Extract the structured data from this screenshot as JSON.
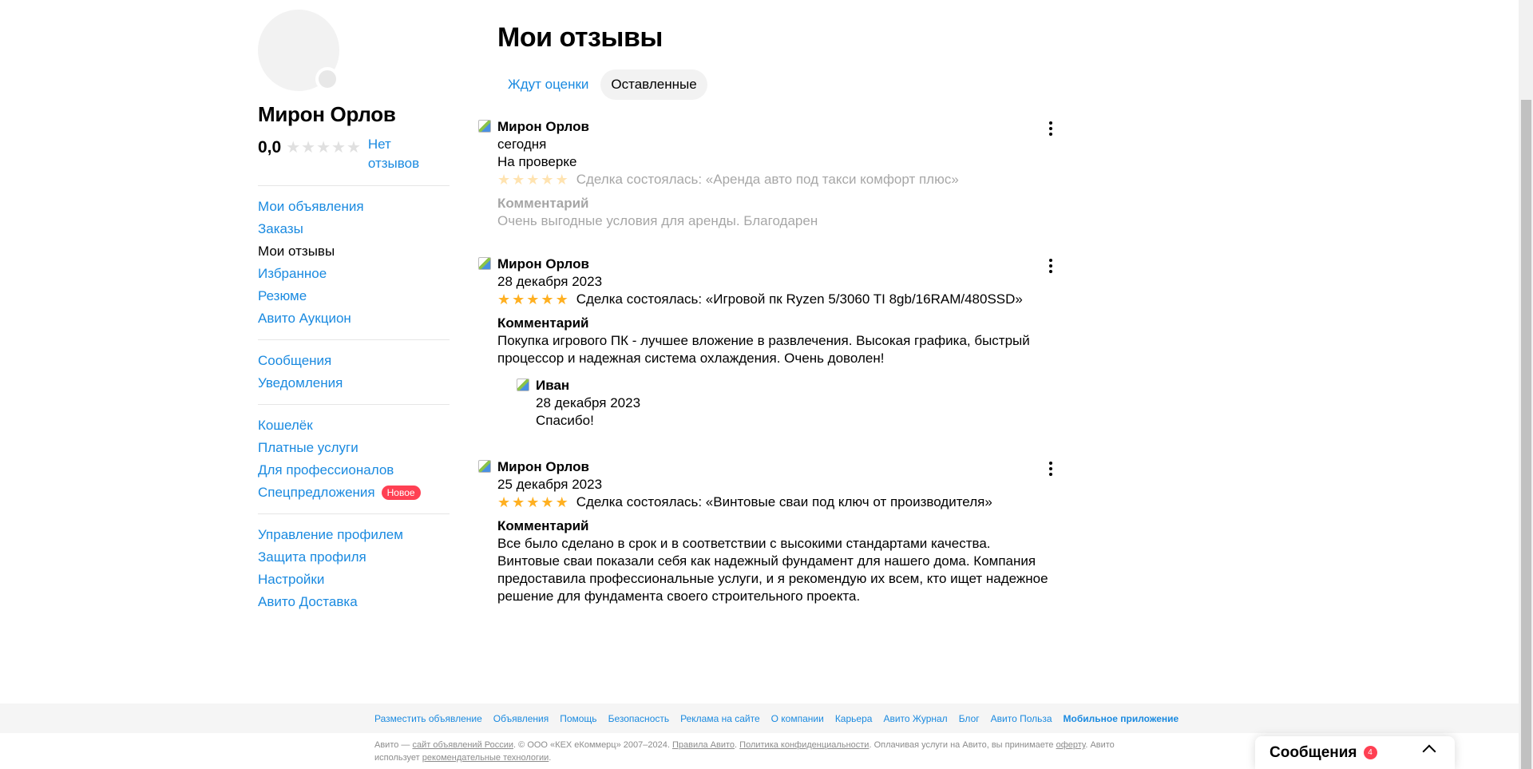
{
  "sidebar": {
    "name": "Мирон Орлов",
    "rating": "0,0",
    "no_reviews": "Нет отзывов",
    "groups": [
      [
        {
          "label": "Мои объявления",
          "active": false
        },
        {
          "label": "Заказы",
          "active": false
        },
        {
          "label": "Мои отзывы",
          "active": true
        },
        {
          "label": "Избранное",
          "active": false
        },
        {
          "label": "Резюме",
          "active": false
        },
        {
          "label": "Авито Аукцион",
          "active": false
        }
      ],
      [
        {
          "label": "Сообщения",
          "active": false
        },
        {
          "label": "Уведомления",
          "active": false
        }
      ],
      [
        {
          "label": "Кошелёк",
          "active": false
        },
        {
          "label": "Платные услуги",
          "active": false
        },
        {
          "label": "Для профессионалов",
          "active": false
        },
        {
          "label": "Спецпредложения",
          "active": false,
          "badge": "Новое"
        }
      ],
      [
        {
          "label": "Управление профилем",
          "active": false
        },
        {
          "label": "Защита профиля",
          "active": false
        },
        {
          "label": "Настройки",
          "active": false
        },
        {
          "label": "Авито Доставка",
          "active": false
        }
      ]
    ]
  },
  "main": {
    "title": "Мои отзывы",
    "tabs": [
      {
        "label": "Ждут оценки",
        "active": false
      },
      {
        "label": "Оставленные",
        "active": true
      }
    ],
    "reviews": [
      {
        "author": "Мирон Орлов",
        "date": "сегодня",
        "status": "На проверке",
        "rating": 5,
        "deal": "Сделка состоялась: «Аренда авто под такси комфорт плюс»",
        "comment_title": "Комментарий",
        "comment": "Очень выгодные условия для аренды. Благодарен",
        "faded": true
      },
      {
        "author": "Мирон Орлов",
        "date": "28 декабря 2023",
        "rating": 5,
        "deal": "Сделка состоялась: «Игровой пк Ryzen 5/3060 TI 8gb/16RAM/480SSD»",
        "comment_title": "Комментарий",
        "comment": "Покупка игрового ПК - лучшее вложение в развлечения. Высокая графика, быстрый процессор и надежная система охлаждения. Очень доволен!",
        "reply": {
          "author": "Иван",
          "date": "28 декабря 2023",
          "text": "Спасибо!"
        }
      },
      {
        "author": "Мирон Орлов",
        "date": "25 декабря 2023",
        "rating": 5,
        "deal": "Сделка состоялась: «Винтовые сваи под ключ от производителя»",
        "comment_title": "Комментарий",
        "comment": "Все было сделано в срок и в соответствии с высокими стандартами качества. Винтовые сваи показали себя как надежный фундамент для нашего дома. Компания предоставила профессиональные услуги, и я рекомендую их всем, кто ищет надежное решение для фундамента своего строительного проекта."
      }
    ]
  },
  "footer": {
    "links": [
      {
        "label": "Разместить объявление"
      },
      {
        "label": "Объявления"
      },
      {
        "label": "Помощь"
      },
      {
        "label": "Безопасность"
      },
      {
        "label": "Реклама на сайте"
      },
      {
        "label": "О компании"
      },
      {
        "label": "Карьера"
      },
      {
        "label": "Авито Журнал"
      },
      {
        "label": "Блог"
      },
      {
        "label": "Авито Польза"
      },
      {
        "label": "Мобильное приложение",
        "bold": true
      }
    ],
    "legal_1": "Авито — ",
    "legal_link_1": "сайт объявлений России",
    "legal_2": ". © ООО «КЕХ еКоммерц» 2007–2024. ",
    "legal_link_2": "Правила Авито",
    "legal_3": ". ",
    "legal_link_3": "Политика конфиденциальности",
    "legal_4": ". Оплачивая услуги на Авито, вы принимаете ",
    "legal_link_4": "оферту",
    "legal_5": ". Авито использует ",
    "legal_link_5": "рекомендательные технологии",
    "legal_6": "."
  },
  "messenger": {
    "title": "Сообщения",
    "count": "4"
  },
  "colors": {
    "link": "#1a8ae0",
    "star": "#ffb021",
    "badge": "#ff4053"
  }
}
